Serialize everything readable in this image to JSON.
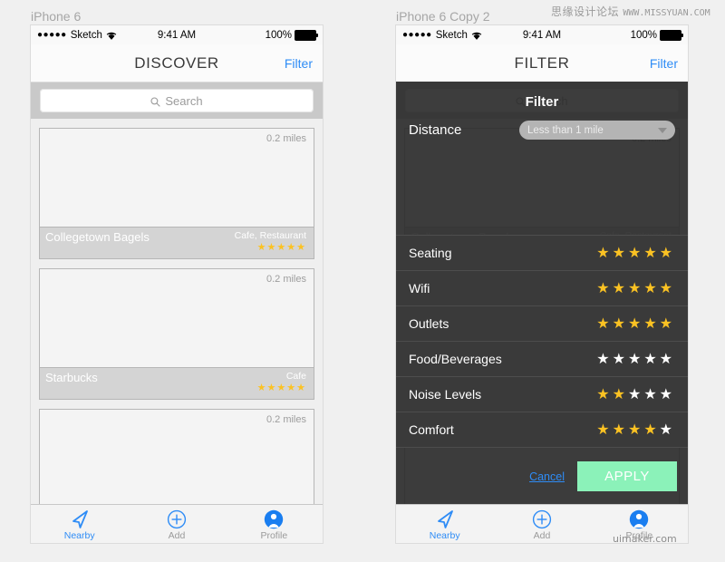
{
  "watermarks": {
    "top_cjk": "思缘设计论坛",
    "top_latin": "WWW.MISSYUAN.COM",
    "bottom": "uimaker.com"
  },
  "artboards": [
    {
      "label": "iPhone 6"
    },
    {
      "label": "iPhone 6 Copy 2"
    }
  ],
  "status_bar": {
    "signal_dots": "●●●●●",
    "carrier": "Sketch",
    "time": "9:41 AM",
    "battery_percent": "100%"
  },
  "discover": {
    "nav": {
      "title": "DISCOVER",
      "action": "Filter"
    },
    "search": {
      "placeholder": "Search",
      "icon": "search-icon"
    },
    "cards": [
      {
        "name": "Collegetown Bagels",
        "category": "Cafe, Restaurant",
        "distance": "0.2 miles",
        "rating": 5
      },
      {
        "name": "Starbucks",
        "category": "Cafe",
        "distance": "0.2 miles",
        "rating": 5
      },
      {
        "name": "",
        "category": "",
        "distance": "0.2 miles",
        "rating": 0
      }
    ]
  },
  "filter_screen": {
    "nav": {
      "title": "FILTER",
      "action": "Filter"
    },
    "heading": "Filter",
    "distance": {
      "label": "Distance",
      "selected": "Less than 1 mile"
    },
    "ratings": [
      {
        "name": "Seating",
        "value": 5
      },
      {
        "name": "Wifi",
        "value": 5
      },
      {
        "name": "Outlets",
        "value": 5
      },
      {
        "name": "Food/Beverages",
        "value": 0
      },
      {
        "name": "Noise Levels",
        "value": 2
      },
      {
        "name": "Comfort",
        "value": 4
      }
    ],
    "actions": {
      "cancel": "Cancel",
      "apply": "APPLY"
    }
  },
  "tabbar": {
    "items": [
      {
        "label": "Nearby",
        "icon": "navigation-arrow-icon",
        "active": true
      },
      {
        "label": "Add",
        "icon": "plus-circle-icon",
        "active": false
      },
      {
        "label": "Profile",
        "icon": "person-avatar-icon",
        "active": false
      }
    ]
  },
  "colors": {
    "accent_blue": "#2e8cf6",
    "star_on": "#fbc223",
    "star_off": "#ffffff",
    "apply_green": "#8bf2b9",
    "overlay": "#282828"
  },
  "max_stars": 5
}
